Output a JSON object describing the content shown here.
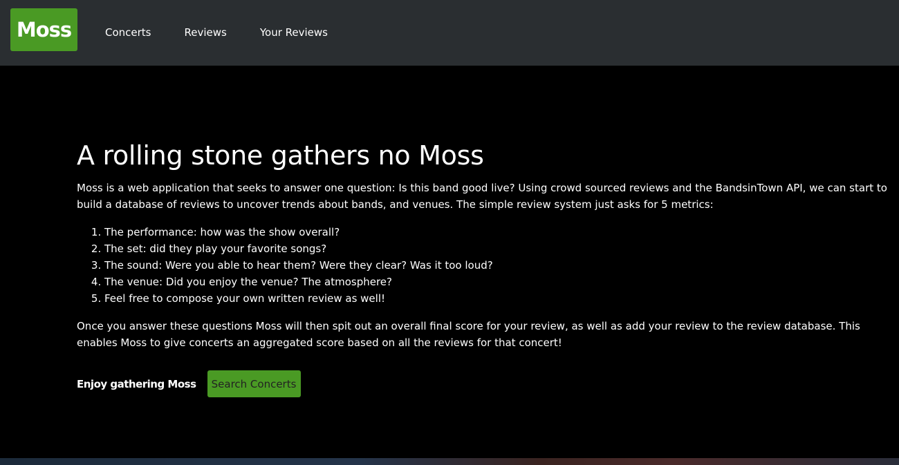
{
  "nav": {
    "brand": "Moss",
    "links": [
      "Concerts",
      "Reviews",
      "Your Reviews"
    ]
  },
  "hero": {
    "title": "A rolling stone gathers no Moss",
    "intro": "Moss is a web application that seeks to answer one question: Is this band good live? Using crowd sourced reviews and the BandsinTown API, we can start to build a database of reviews to uncover trends about bands, and venues. The simple review system just asks for 5 metrics:",
    "metrics": [
      "The performance: how was the show overall?",
      "The set: did they play your favorite songs?",
      "The sound: Were you able to hear them? Were they clear? Was it too loud?",
      "The venue: Did you enjoy the venue? The atmosphere?",
      "Feel free to compose your own written review as well!"
    ],
    "outro": "Once you answer these questions Moss will then spit out an overall final score for your review, as well as add your review to the review database. This enables Moss to give concerts an aggregated score based on all the reviews for that concert!"
  },
  "cta": {
    "text": "Enjoy gathering Moss",
    "button": "Search Concerts"
  },
  "colors": {
    "brand_green": "#4a9a24",
    "navbar_bg": "#2a2e31",
    "page_bg": "#000000"
  }
}
